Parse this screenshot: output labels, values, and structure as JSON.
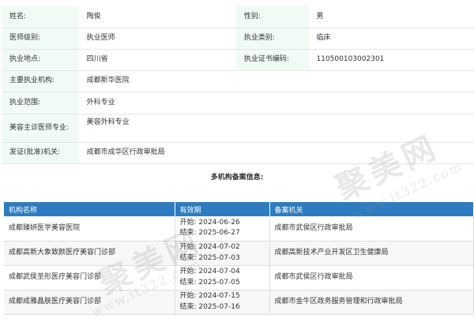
{
  "doctor": {
    "name_label": "姓名:",
    "name": "陶俊",
    "gender_label": "性别:",
    "gender": "男",
    "level_label": "医师级别:",
    "level": "执业医师",
    "category_label": "执业类别:",
    "category": "临床",
    "location_label": "执业地点:",
    "location": "四川省",
    "cert_label": "执业证书编码:",
    "cert": "110500103002301",
    "org_label": "主要执业机构:",
    "org": "成都新华医院",
    "range_label": "执业范围:",
    "range": "外科专业",
    "beauty_label": "美容主诊医师专业:",
    "beauty": "美容外科专业",
    "issuer_label": "发证(批准)机关:",
    "issuer": "成都市成华区行政审批局"
  },
  "multi_title": "多机构备案信息:",
  "org_table": {
    "headers": [
      "机构名称",
      "有效期",
      "备案机关"
    ],
    "rows": [
      {
        "name": "成都臻妍医学美容医院",
        "start": "开始: 2024-06-26",
        "end": "结束: 2025-06-27",
        "authority": "成都市武侯区行政审批局"
      },
      {
        "name": "成都高新大象致颜医疗美容门诊部",
        "start": "开始: 2024-07-02",
        "end": "结束: 2025-07-03",
        "authority": "成都高新技术产业开发区卫生健康局"
      },
      {
        "name": "成都武侯圣形医疗美容门诊部",
        "start": "开始: 2024-07-04",
        "end": "结束: 2025-07-05",
        "authority": "成都市武侯区行政审批局"
      },
      {
        "name": "成都成雅晶肤医疗美容门诊部",
        "start": "开始: 2024-07-15",
        "end": "结束: 2025-07-16",
        "authority": "成都市金牛区政务服务管理和行政审批局"
      }
    ]
  },
  "watermark": {
    "brand": "聚美网",
    "url": "www.it322.com"
  }
}
